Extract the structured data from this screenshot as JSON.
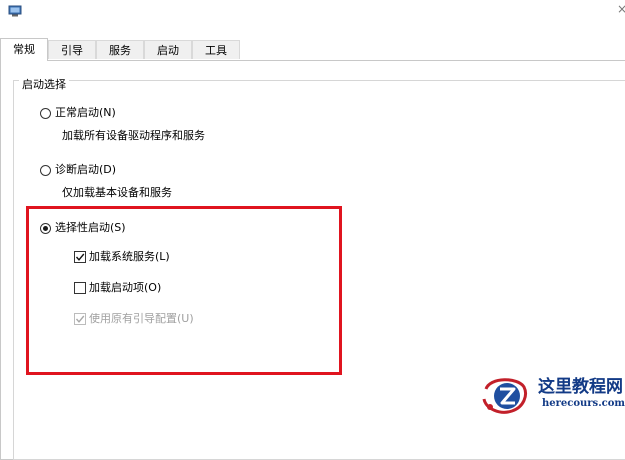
{
  "window": {
    "icon": "msconfig-app-icon",
    "close_glyph": "×"
  },
  "tabs": [
    {
      "label": "常规",
      "active": true
    },
    {
      "label": "引导",
      "active": false
    },
    {
      "label": "服务",
      "active": false
    },
    {
      "label": "启动",
      "active": false
    },
    {
      "label": "工具",
      "active": false
    }
  ],
  "startup_selection": {
    "legend": "启动选择",
    "normal": {
      "label": "正常启动(N)",
      "desc": "加载所有设备驱动程序和服务",
      "selected": false
    },
    "diagnostic": {
      "label": "诊断启动(D)",
      "desc": "仅加载基本设备和服务",
      "selected": false
    },
    "selective": {
      "label": "选择性启动(S)",
      "selected": true,
      "options": [
        {
          "label": "加载系统服务(L)",
          "checked": true,
          "enabled": true
        },
        {
          "label": "加载启动项(O)",
          "checked": false,
          "enabled": true
        },
        {
          "label": "使用原有引导配置(U)",
          "checked": true,
          "enabled": false
        }
      ]
    }
  },
  "highlight_color": "#e0141f",
  "watermark": {
    "title": "这里教程网",
    "url": "herecours.com",
    "logo_icon": "z-logo-icon"
  }
}
